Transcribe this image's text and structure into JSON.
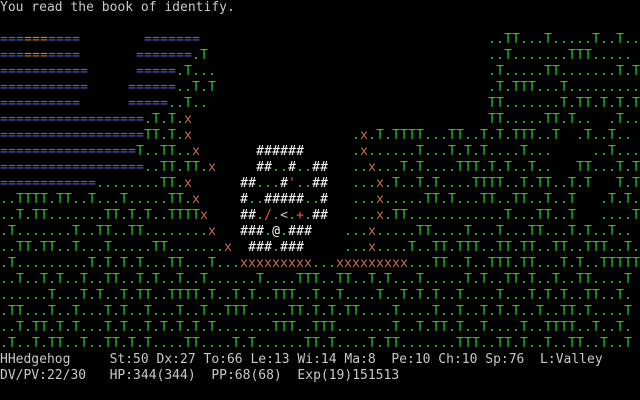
{
  "message": "You read the book of identify.",
  "map": {
    "rows": [
      "                                                                                ",
      "                                                                                ",
      "==========        =======                                    ..TT...T.....T..T..T",
      "==========       =======.T                                   ..T.......TTT.....",
      "===========      =====.T...                                  .T.....TT.......T.T",
      "===========     ======..T.T                                  .T.TTT...T.........T",
      "==========      =====..T..                                   TT.......T.TT.T.T.T",
      "==================.T.T.X                                     TT.....TT.T..  .T...",
      "==================TT.T.X                    .X.T.TTTT...TT..T.T.TTT..T  .T..T..",
      "=================T..TT..X       ######      .X......T...T.T.T....T...     ..T....",
      "==================..TT.TT.X     ##..#..##   ..X...T.T....TTT.T.T..T..   TT...T.T",
      "============........TT.X      ##...#'..##   ...X.T..T.T....TTTT..T.TT..T.T   T.T.TT",
      "..TTTT.TT..T...T.....TT.X     #..#####..#   ...X.....TT.T...TT..TT..T..T   .T.T.",
      "..T.TT.......TT.T.T..TTTTX    ##./.<.+.##   ...X.TT............T...TT..T   ....TT.",
      ".T.......T..TT..TT........X   ###.@.###    ...X.....TT....T...T...TT...T.T..T..",
      "..TT.TT..T...T.....TT.......X  ###.###     ...X....T..TT.TTT..TT.TT..TT..TTT..T.",
      ".T.........T.T.T.T...TT...T...XXXXXXXXX...XXXXXXXXX...TT..T..TTT.TT...T.T..TTTTTT",
      "..T..T.T..T..TT..T.T..T..T......T....TTT..TT..T.T...T.....T.T..TT.T..T..TT....T",
      "......T...T.T..T.TT..TTTT.T..T.T..TTT..T..T....T..T.T.T..T....T...T.T.T..TT..T.",
      ".TT...T..T...T.T..T...T..T..TTT.....TT.T.T.TT....T....T..T..T.T.T..T..TT.T....T",
      "..T.TT.T.T...T.T..T.T.T.T.T.......TTT..TTT.......T..T.TT.T..T....T..TTTT..T..T.",
      ".T..T.TT..T..TT.T.T....TT....T.T......TT.T....T.TT.......TTT..TT.T..T..TT..T..T"
    ],
    "water_color": "#5a5af0",
    "deep_water_color": "#e07030",
    "tree_color": "#2cc02c",
    "floor_color": "#2cc02c",
    "fence_color": "#c0704a",
    "wall_color": "#ffffff",
    "player_color": "#ffffff",
    "item_color": "#ff5050",
    "text_color": "#c8c8c8"
  },
  "status": {
    "line1": "HHedgehog     St:50 Dx:27 To:66 Le:13 Wi:14 Ma:8  Pe:10 Ch:10 Sp:76  L:Valley",
    "line2": "DV/PV:22/30   HP:344(344)  PP:68(68)  Exp(19)151513"
  }
}
